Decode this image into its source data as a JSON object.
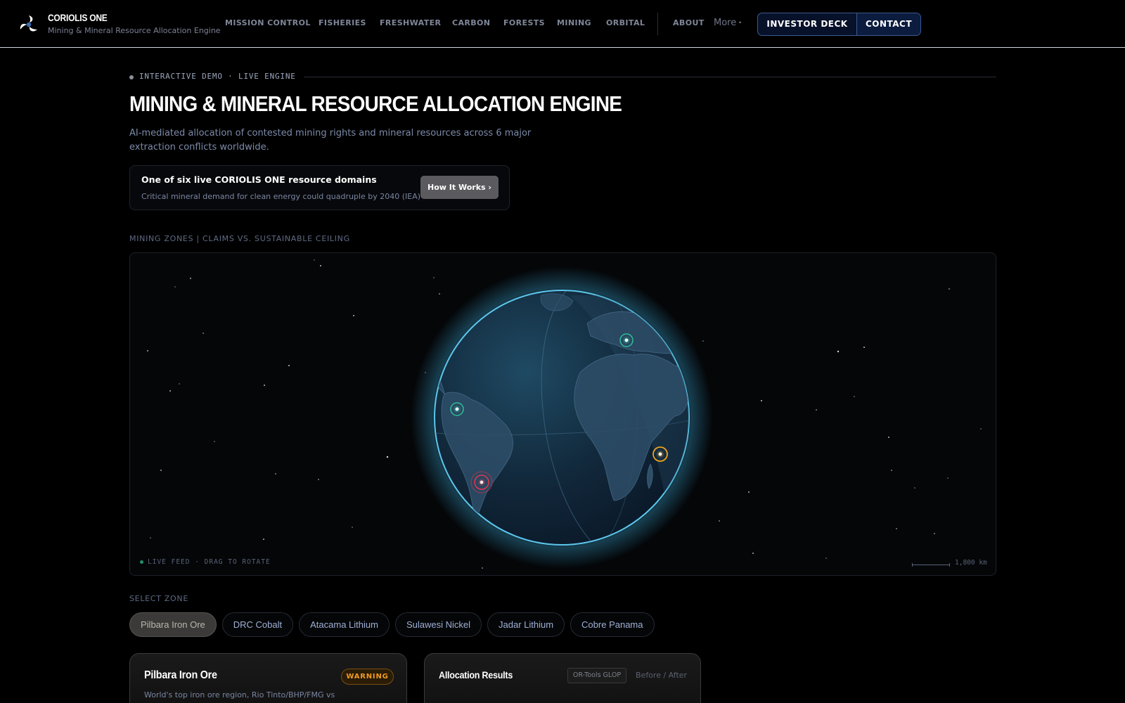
{
  "brand": {
    "name": "CORIOLIS ONE",
    "subtitle": "Mining & Mineral Resource Allocation Engine"
  },
  "nav": {
    "items": [
      "MISSION CONTROL",
      "FISHERIES",
      "FRESHWATER",
      "CARBON",
      "FORESTS",
      "MINING",
      "ORBITAL",
      "ABOUT"
    ],
    "more_label": "More",
    "more_glyph": "•",
    "investor_deck": "INVESTOR DECK",
    "contact": "CONTACT"
  },
  "intro": {
    "eyebrow": "INTERACTIVE DEMO · LIVE ENGINE",
    "title": "MINING & MINERAL RESOURCE ALLOCATION ENGINE",
    "subtitle": "AI-mediated allocation of contested mining rights and mineral resources across 6 major extraction conflicts worldwide."
  },
  "domain_card": {
    "title": "One of six live CORIOLIS ONE resource domains",
    "subtitle": "Critical mineral demand for clean energy could quadruple by 2040 (IEA)",
    "button": "How It Works ›"
  },
  "map": {
    "section_label": "MINING ZONES | CLAIMS VS. SUSTAINABLE CEILING",
    "footer_left": "LIVE FEED · DRAG TO ROTATE",
    "scale_label": "1,800 km",
    "marker_colors": {
      "ok": "#2fd1a0",
      "warning": "#f0a21f",
      "critical": "#e8344b"
    }
  },
  "zones": {
    "label": "SELECT ZONE",
    "items": [
      "Pilbara Iron Ore",
      "DRC Cobalt",
      "Atacama Lithium",
      "Sulawesi Nickel",
      "Jadar Lithium",
      "Cobre Panama"
    ],
    "selected": "Pilbara Iron Ore"
  },
  "zone_card": {
    "title": "Pilbara Iron Ore",
    "status": "WARNING",
    "description": "World's top iron ore region, Rio Tinto/BHP/FMG vs traditional"
  },
  "results_card": {
    "title": "Allocation Results",
    "solver": "OR-Tools GLOP",
    "toggle": "Before / After"
  },
  "colors": {
    "accent": "#3c5a8f",
    "globe_glow": "#3aa6d4",
    "warning": "#f09a22"
  }
}
